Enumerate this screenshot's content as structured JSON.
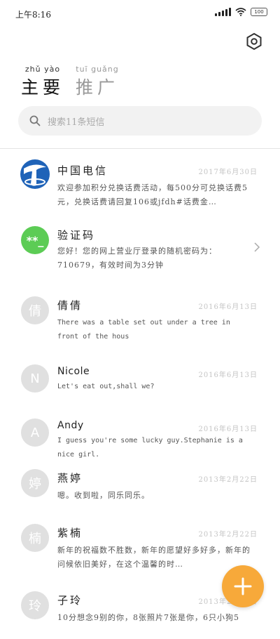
{
  "status_bar": {
    "time": "上午8:16",
    "battery": "100"
  },
  "tabs": [
    {
      "pinyin": "zhǔ yào",
      "label": "主要",
      "active": true
    },
    {
      "pinyin": "tuī guǎng",
      "label": "推广",
      "active": false
    }
  ],
  "search": {
    "placeholder": "搜索11条短信"
  },
  "conversations": [
    {
      "avatar": "",
      "avatar_color": "#ffffff",
      "name": "中国电信",
      "date": "2017年6月30日",
      "preview": "欢迎参加积分兑换话费活动，每500分可兑换话费5元，兑换话费请回复106或jfdh#话费金…"
    },
    {
      "avatar": "**_",
      "avatar_color": "#5ccc55",
      "name": "验证码",
      "date": "",
      "preview": "您好！您的网上营业厅登录的随机密码为：710679，有效时间为3分钟"
    },
    {
      "avatar": "倩",
      "avatar_color": "#e0e0e0",
      "name": "倩倩",
      "date": "2016年6月13日",
      "preview": "There was a table set out under a tree in front of the hous"
    },
    {
      "avatar": "N",
      "avatar_color": "#e0e0e0",
      "name": "Nicole",
      "date": "2016年6月13日",
      "preview": "Let's eat out,shall we?"
    },
    {
      "avatar": "A",
      "avatar_color": "#e0e0e0",
      "name": "Andy",
      "date": "2016年6月13日",
      "preview": "I guess you're some lucky guy.Stephanie is a nice girl."
    },
    {
      "avatar": "婷",
      "avatar_color": "#e0e0e0",
      "name": "燕婷",
      "date": "2013年2月22日",
      "preview": "嗯。收到啦，同乐同乐。"
    },
    {
      "avatar": "楠",
      "avatar_color": "#e0e0e0",
      "name": "紫楠",
      "date": "2013年2月22日",
      "preview": "新年的祝福数不胜数，新年的愿望好多好多，新年的问候依旧美好，在这个温馨的时…"
    },
    {
      "avatar": "玲",
      "avatar_color": "#e0e0e0",
      "name": "子玲",
      "date": "2013年2月22日",
      "preview": "10分想念9别的你，8张照片7张是你，6只小狗5"
    }
  ],
  "colors": {
    "accent": "#f7a93a",
    "verification": "#5ccc55",
    "telecom": "#1f63b8"
  },
  "icons": {
    "settings": "hexagon-gear-icon",
    "search": "search-icon",
    "fab": "plus-icon",
    "chevron": "chevron-right-icon"
  }
}
